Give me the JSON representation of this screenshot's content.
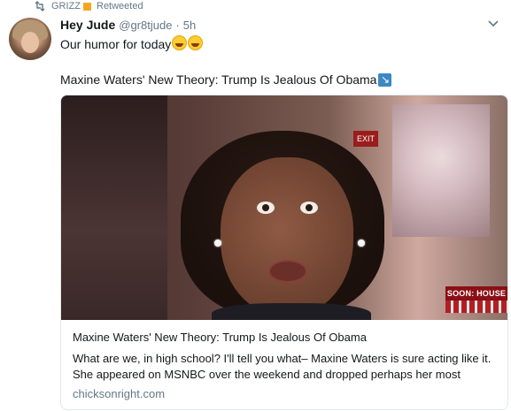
{
  "retweet": {
    "user": "GRIZZ",
    "label": "Retweeted"
  },
  "tweet": {
    "author_name": "Hey Jude",
    "handle": "@gr8tjude",
    "separator": "·",
    "time": "5h",
    "text": "Our humor for today",
    "emojis": [
      "face-with-tears-of-joy",
      "face-with-tears-of-joy"
    ],
    "link_title": "Maxine Waters' New Theory: Trump Is Jealous Of Obama",
    "link_icon": "arrow-down-right-icon"
  },
  "card": {
    "image_chyron": "SOON: HOUSE",
    "image_exit_sign": "EXIT",
    "title": "Maxine Waters' New Theory: Trump Is Jealous Of Obama",
    "description_line1": "What are we, in high school? I'll tell you what– Maxine Waters is sure acting like it.",
    "description_line2": "She appeared on MSNBC over the weekend and dropped perhaps her most",
    "domain": "chicksonright.com"
  },
  "colors": {
    "secondary_text": "#657786",
    "border": "#e1e8ed",
    "arrow_box": "#3b88c3",
    "chyron": "#8b0f14"
  }
}
